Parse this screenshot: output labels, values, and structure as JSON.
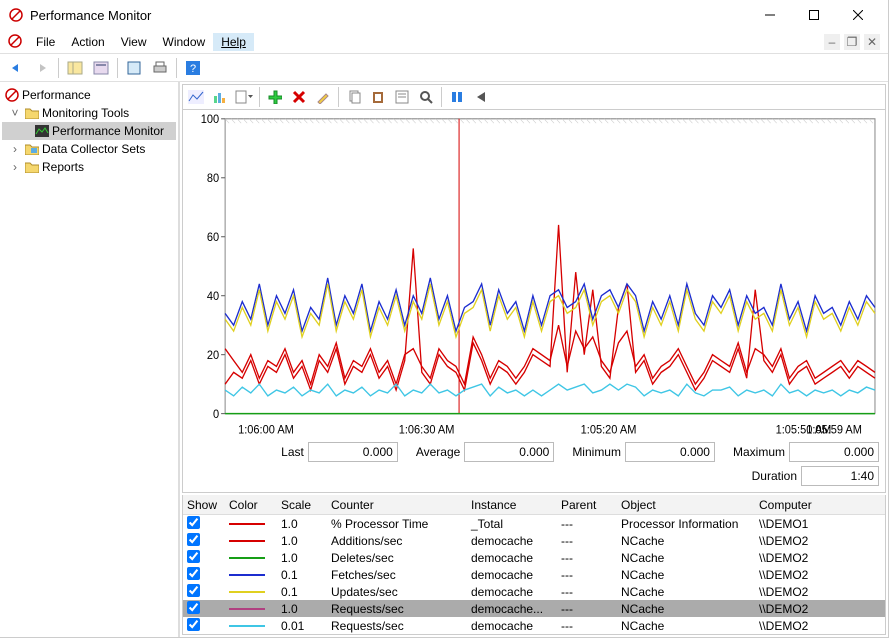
{
  "window": {
    "title": "Performance Monitor"
  },
  "menu": {
    "file": "File",
    "action": "Action",
    "view": "View",
    "windowMenu": "Window",
    "help": "Help"
  },
  "tree": {
    "root": "Performance",
    "monitoringTools": "Monitoring Tools",
    "perfmon": "Performance Monitor",
    "dcs": "Data Collector Sets",
    "reports": "Reports"
  },
  "stats": {
    "lastLabel": "Last",
    "lastVal": "0.000",
    "avgLabel": "Average",
    "avgVal": "0.000",
    "minLabel": "Minimum",
    "minVal": "0.000",
    "maxLabel": "Maximum",
    "maxVal": "0.000",
    "durLabel": "Duration",
    "durVal": "1:40"
  },
  "gridHeaders": {
    "show": "Show",
    "color": "Color",
    "scale": "Scale",
    "counter": "Counter",
    "instance": "Instance",
    "parent": "Parent",
    "object": "Object",
    "computer": "Computer"
  },
  "counters": [
    {
      "color": "#d60000",
      "scale": "1.0",
      "counter": "% Processor Time",
      "instance": "_Total",
      "parent": "---",
      "object": "Processor Information",
      "computer": "\\\\DEMO1",
      "selected": false
    },
    {
      "color": "#d60000",
      "scale": "1.0",
      "counter": "Additions/sec",
      "instance": "democache",
      "parent": "---",
      "object": "NCache",
      "computer": "\\\\DEMO2",
      "selected": false
    },
    {
      "color": "#169e16",
      "scale": "1.0",
      "counter": "Deletes/sec",
      "instance": "democache",
      "parent": "---",
      "object": "NCache",
      "computer": "\\\\DEMO2",
      "selected": false
    },
    {
      "color": "#1c2dcf",
      "scale": "0.1",
      "counter": "Fetches/sec",
      "instance": "democache",
      "parent": "---",
      "object": "NCache",
      "computer": "\\\\DEMO2",
      "selected": false
    },
    {
      "color": "#e0d020",
      "scale": "0.1",
      "counter": "Updates/sec",
      "instance": "democache",
      "parent": "---",
      "object": "NCache",
      "computer": "\\\\DEMO2",
      "selected": false
    },
    {
      "color": "#b04080",
      "scale": "1.0",
      "counter": "Requests/sec",
      "instance": "democache...",
      "parent": "---",
      "object": "NCache",
      "computer": "\\\\DEMO2",
      "selected": true
    },
    {
      "color": "#3fc6e5",
      "scale": "0.01",
      "counter": "Requests/sec",
      "instance": "democache",
      "parent": "---",
      "object": "NCache",
      "computer": "\\\\DEMO2",
      "selected": false
    }
  ],
  "chart_data": {
    "type": "line",
    "ylim": [
      0,
      100
    ],
    "yticks": [
      0,
      20,
      40,
      60,
      80,
      100
    ],
    "xlabels": [
      "1:06:00 AM",
      "1:06:30 AM",
      "1:05:20 AM",
      "1:05:50 AM",
      "1:05:59 AM"
    ],
    "xlabel_positions": [
      0.02,
      0.31,
      0.59,
      0.89,
      0.98
    ],
    "cursor_x": 0.36,
    "series": [
      {
        "name": "% Processor Time",
        "color": "#d60000",
        "values": [
          10,
          14,
          12,
          18,
          10,
          16,
          14,
          20,
          12,
          16,
          8,
          18,
          14,
          22,
          10,
          16,
          14,
          20,
          12,
          16,
          8,
          18,
          56,
          14,
          10,
          20,
          16,
          14,
          8,
          24,
          18,
          10,
          16,
          14,
          10,
          14,
          20,
          18,
          16,
          64,
          14,
          48,
          20,
          42,
          16,
          12,
          36,
          44,
          14,
          18,
          10,
          14,
          16,
          20,
          14,
          8,
          12,
          18,
          16,
          14,
          22,
          12,
          42,
          18,
          14,
          20,
          10,
          14,
          16,
          10,
          12,
          14,
          16,
          12,
          16,
          14,
          12
        ]
      },
      {
        "name": "Additions/sec",
        "color": "#d60000",
        "values": [
          22,
          18,
          14,
          20,
          12,
          18,
          16,
          22,
          14,
          18,
          10,
          20,
          16,
          24,
          12,
          18,
          16,
          22,
          14,
          18,
          10,
          20,
          22,
          16,
          12,
          22,
          18,
          16,
          10,
          26,
          20,
          12,
          18,
          16,
          12,
          16,
          22,
          20,
          18,
          30,
          16,
          28,
          22,
          26,
          18,
          14,
          24,
          28,
          16,
          20,
          12,
          16,
          18,
          22,
          16,
          10,
          14,
          20,
          18,
          16,
          24,
          14,
          22,
          20,
          16,
          22,
          12,
          16,
          18,
          12,
          14,
          16,
          18,
          14,
          18,
          16,
          14
        ]
      },
      {
        "name": "Deletes/sec",
        "color": "#169e16",
        "values": [
          0,
          0,
          0,
          0,
          0,
          0,
          0,
          0,
          0,
          0,
          0,
          0,
          0,
          0,
          0,
          0,
          0,
          0,
          0,
          0,
          0,
          0,
          0,
          0,
          0,
          0,
          0,
          0,
          0,
          0,
          0,
          0,
          0,
          0,
          0,
          0,
          0,
          0,
          0,
          0,
          0,
          0,
          0,
          0,
          0,
          0,
          0,
          0,
          0,
          0,
          0,
          0,
          0,
          0,
          0,
          0,
          0,
          0,
          0,
          0,
          0,
          0,
          0,
          0,
          0,
          0,
          0,
          0,
          0,
          0,
          0,
          0,
          0,
          0,
          0,
          0,
          0
        ]
      },
      {
        "name": "Fetches/sec",
        "color": "#1c2dcf",
        "values": [
          34,
          30,
          38,
          32,
          44,
          30,
          40,
          34,
          42,
          28,
          36,
          32,
          46,
          30,
          40,
          34,
          44,
          28,
          38,
          32,
          42,
          30,
          40,
          34,
          46,
          32,
          40,
          28,
          36,
          38,
          44,
          30,
          42,
          34,
          38,
          28,
          40,
          30,
          40,
          42,
          36,
          38,
          44,
          32,
          40,
          42,
          36,
          44,
          40,
          28,
          38,
          32,
          40,
          30,
          44,
          34,
          30,
          40,
          36,
          42,
          30,
          40,
          34,
          36,
          30,
          44,
          32,
          38,
          28,
          40,
          34,
          36,
          30,
          38,
          32,
          40,
          36
        ]
      },
      {
        "name": "Updates/sec",
        "color": "#e0d020",
        "values": [
          32,
          28,
          36,
          30,
          42,
          28,
          38,
          32,
          40,
          26,
          34,
          30,
          44,
          28,
          38,
          32,
          42,
          26,
          36,
          30,
          40,
          28,
          38,
          32,
          44,
          30,
          38,
          26,
          34,
          36,
          42,
          28,
          40,
          32,
          36,
          26,
          38,
          28,
          38,
          40,
          34,
          36,
          42,
          30,
          38,
          40,
          34,
          42,
          38,
          26,
          36,
          30,
          38,
          28,
          42,
          32,
          28,
          38,
          34,
          40,
          28,
          38,
          32,
          34,
          28,
          42,
          30,
          36,
          26,
          38,
          32,
          34,
          28,
          36,
          30,
          38,
          34
        ]
      },
      {
        "name": "Requests/sec",
        "color": "#3fc6e5",
        "values": [
          8,
          6,
          9,
          7,
          10,
          6,
          8,
          7,
          9,
          6,
          8,
          7,
          10,
          6,
          8,
          7,
          9,
          6,
          8,
          7,
          10,
          6,
          8,
          7,
          10,
          7,
          8,
          6,
          8,
          9,
          10,
          6,
          9,
          7,
          8,
          6,
          8,
          6,
          8,
          10,
          8,
          9,
          10,
          7,
          8,
          10,
          8,
          10,
          9,
          6,
          8,
          7,
          8,
          6,
          10,
          7,
          6,
          8,
          8,
          9,
          6,
          8,
          7,
          8,
          6,
          10,
          7,
          8,
          6,
          8,
          7,
          8,
          6,
          8,
          7,
          9,
          8
        ]
      }
    ]
  }
}
